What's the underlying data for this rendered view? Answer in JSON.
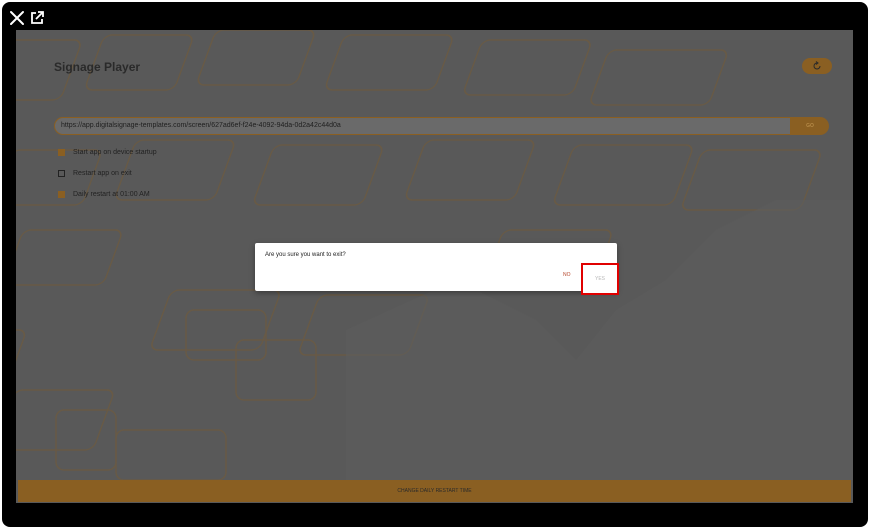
{
  "window": {
    "close_icon": "close-icon",
    "open_external_icon": "open-external-icon"
  },
  "app": {
    "title": "Signage Player",
    "refresh_icon": "refresh-icon"
  },
  "url_bar": {
    "value": "https://app.digitalsignage-templates.com/screen/627ad6ef-f24e-4092-94da-0d2a42c44d0a",
    "go_label": "GO"
  },
  "options": [
    {
      "label": "Start app on device startup",
      "checked": true
    },
    {
      "label": "Restart app on exit",
      "checked": false
    },
    {
      "label": "Daily restart at 01:00 AM",
      "checked": true
    }
  ],
  "dialog": {
    "message": "Are you sure you want to exit?",
    "no_label": "NO",
    "yes_label": "YES"
  },
  "bottom_bar": {
    "label": "CHANGE DAILY RESTART TIME"
  },
  "colors": {
    "accent": "#8a5f22",
    "overlay": "#595959",
    "highlight": "#e00000"
  }
}
